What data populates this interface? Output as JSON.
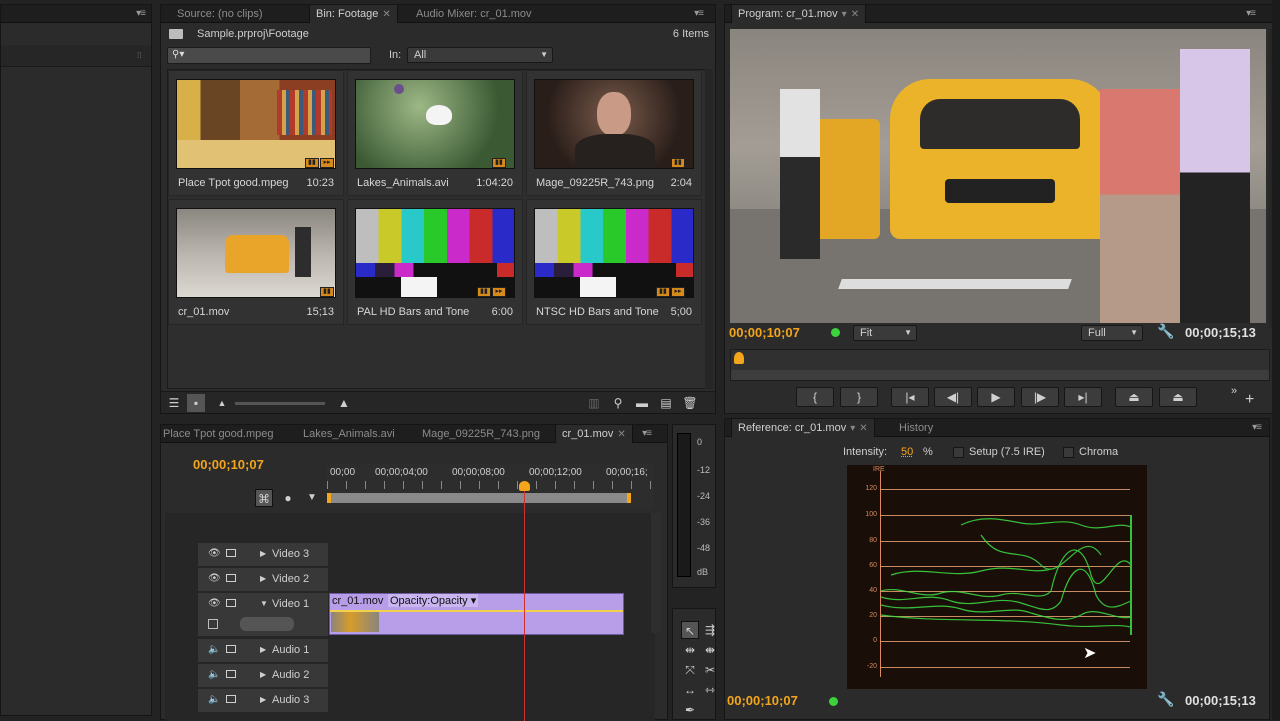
{
  "left_panel": {},
  "project": {
    "tabs": [
      {
        "label": "Source: (no clips)"
      },
      {
        "label": "Bin: Footage"
      },
      {
        "label": "Audio Mixer: cr_01.mov"
      }
    ],
    "path": "Sample.prproj\\Footage",
    "item_count": "6 Items",
    "search_placeholder": "",
    "in_label": "In:",
    "in_value": "All",
    "clips": [
      {
        "name": "Place Tpot good.mpeg",
        "duration": "10:23",
        "thumb": "room"
      },
      {
        "name": "Lakes_Animals.avi",
        "duration": "1:04:20",
        "thumb": "butterfly"
      },
      {
        "name": "Mage_09225R_743.png",
        "duration": "2:04",
        "thumb": "man"
      },
      {
        "name": "cr_01.mov",
        "duration": "15;13",
        "thumb": "taxi"
      },
      {
        "name": "PAL HD Bars and Tone",
        "duration": "6:00",
        "thumb": "bars"
      },
      {
        "name": "NTSC HD Bars and Tone",
        "duration": "5;00",
        "thumb": "bars"
      }
    ]
  },
  "program": {
    "tab_label": "Program: cr_01.mov",
    "timecode_current": "00;00;10;07",
    "fit_value": "Fit",
    "quality_value": "Full",
    "timecode_duration": "00;00;15;13"
  },
  "timeline": {
    "tabs": [
      {
        "label": "Place Tpot good.mpeg"
      },
      {
        "label": "Lakes_Animals.avi"
      },
      {
        "label": "Mage_09225R_743.png"
      },
      {
        "label": "cr_01.mov"
      }
    ],
    "timecode": "00;00;10;07",
    "ruler": [
      "00;00",
      "00;00;04;00",
      "00;00;08;00",
      "00;00;12;00",
      "00;00;16;"
    ],
    "tracks": [
      {
        "label": "Video 3",
        "kind": "video"
      },
      {
        "label": "Video 2",
        "kind": "video"
      },
      {
        "label": "Video 1",
        "kind": "video"
      },
      {
        "label": "Audio 1",
        "kind": "audio"
      },
      {
        "label": "Audio 2",
        "kind": "audio"
      },
      {
        "label": "Audio 3",
        "kind": "audio"
      }
    ],
    "clip_name": "cr_01.mov",
    "clip_effect": "Opacity:Opacity",
    "playhead_fraction": 0.66
  },
  "meter": {
    "ticks": [
      "0",
      "-12",
      "-24",
      "-36",
      "-48",
      "dB"
    ]
  },
  "reference": {
    "tabs": [
      {
        "label": "Reference: cr_01.mov"
      },
      {
        "label": "History"
      }
    ],
    "intensity_label": "Intensity:",
    "intensity_value": "50",
    "intensity_unit": "%",
    "setup_label": "Setup (7.5 IRE)",
    "chroma_label": "Chroma",
    "scope_unit": "IRE",
    "scope_ticks": [
      "120",
      "100",
      "80",
      "60",
      "40",
      "20",
      "0",
      "-20"
    ],
    "timecode_current": "00;00;10;07",
    "timecode_duration": "00;00;15;13"
  },
  "colors": {
    "accent": "#f3a51b",
    "clip": "#b89ee8",
    "playhead": "#d03030",
    "waveform": "#3de043"
  }
}
